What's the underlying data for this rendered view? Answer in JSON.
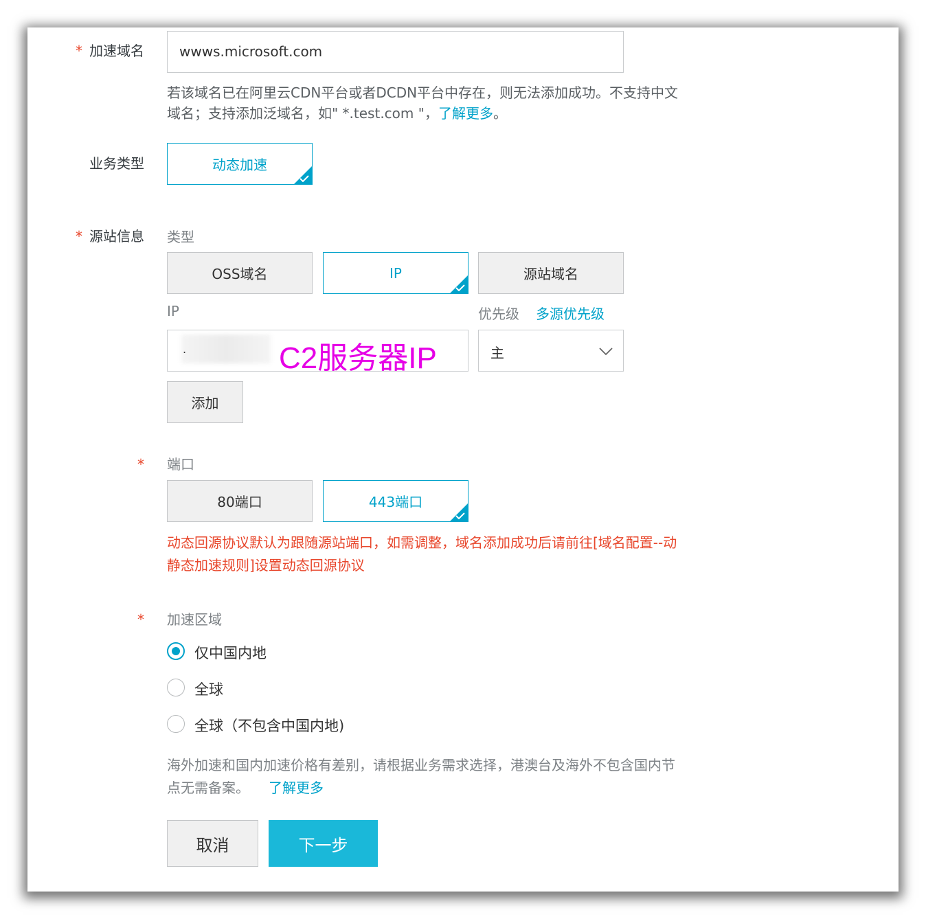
{
  "domain_field": {
    "required_mark": "*",
    "label": "加速域名",
    "value": "wwws.microsoft.com",
    "help_line1": "若该域名已在阿里云CDN平台或者DCDN平台中存在，则无法添加成功。不支持中文",
    "help_line2_prefix": "域名；支持添加泛域名，如\" *.test.com \"，",
    "help_link": "了解更多",
    "help_line2_suffix": "。"
  },
  "business_type": {
    "label": "业务类型",
    "option": "动态加速"
  },
  "origin": {
    "required_mark": "*",
    "label": "源站信息",
    "type_label": "类型",
    "types": [
      "OSS域名",
      "IP",
      "源站域名"
    ],
    "selected_type": "IP",
    "ip_label": "IP",
    "priority_label": "优先级",
    "priority_link": "多源优先级",
    "ip_value": ".",
    "ip_overlay_annotation": "C2服务器IP",
    "priority_value": "主",
    "add_button": "添加"
  },
  "port": {
    "required_mark": "*",
    "label": "端口",
    "options": [
      "80端口",
      "443端口"
    ],
    "selected": "443端口",
    "warning_line1": "动态回源协议默认为跟随源站端口，如需调整，域名添加成功后请前往[域名配置--动",
    "warning_line2": "静态加速规则]设置动态回源协议"
  },
  "region": {
    "required_mark": "*",
    "label": "加速区域",
    "options": [
      "仅中国内地",
      "全球",
      "全球（不包含中国内地)"
    ],
    "selected": "仅中国内地",
    "help_line1": "海外加速和国内加速价格有差别，请根据业务需求选择，港澳台及海外不包含国内节",
    "help_line2": "点无需备案。",
    "help_link": "了解更多"
  },
  "actions": {
    "cancel": "取消",
    "next": "下一步"
  },
  "colors": {
    "accent": "#00a2ca",
    "required": "#e8472c",
    "annotation": "#e600e6",
    "next_button": "#1ab8d9"
  }
}
